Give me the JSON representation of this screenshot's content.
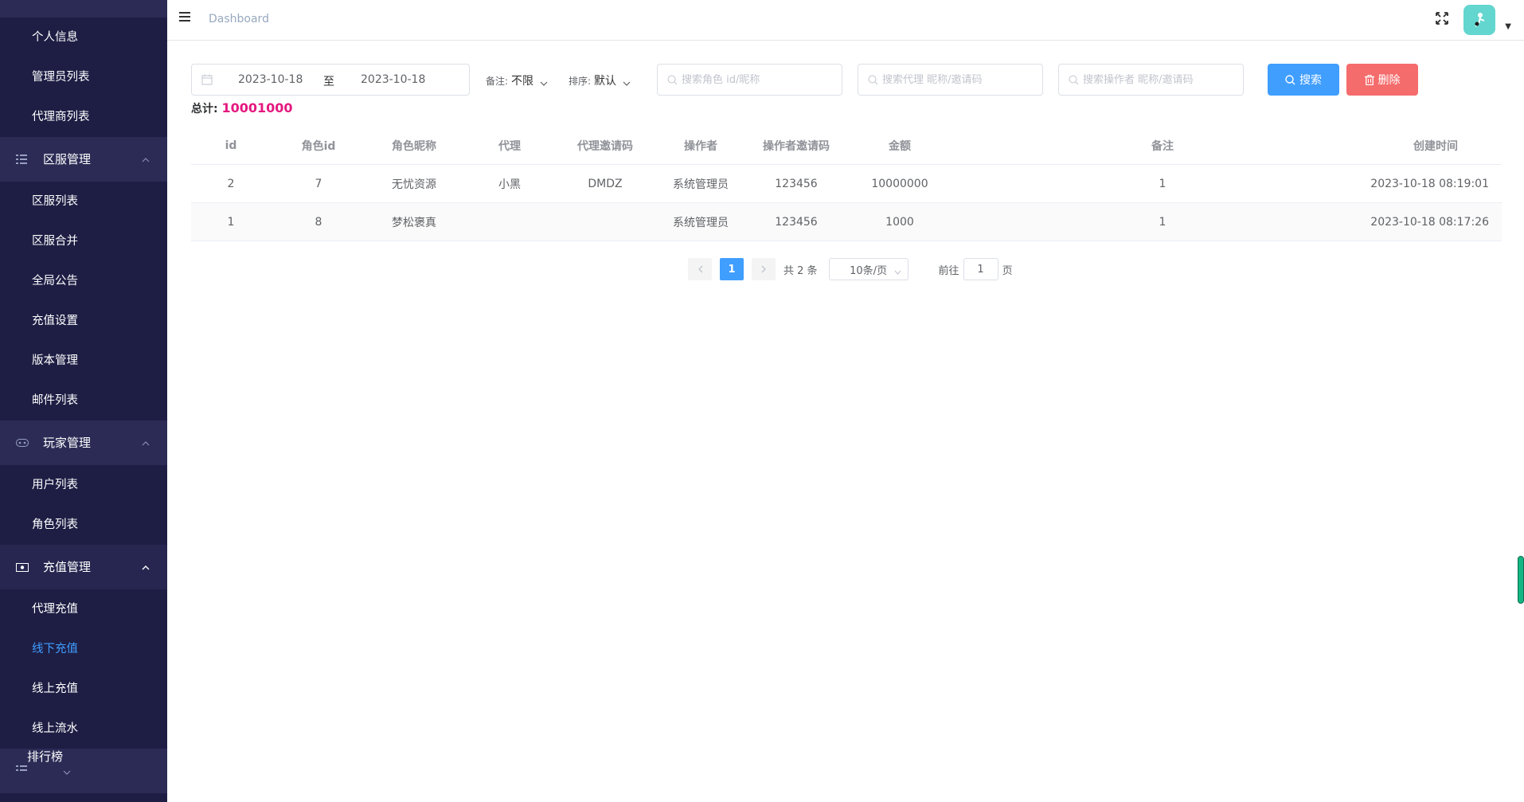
{
  "sidebar": {
    "items_top": [
      {
        "label": "个人信息"
      },
      {
        "label": "管理员列表"
      },
      {
        "label": "代理商列表"
      }
    ],
    "group_server": {
      "label": "区服管理",
      "icon": "list-icon"
    },
    "items_server": [
      {
        "label": "区服列表"
      },
      {
        "label": "区服合并"
      },
      {
        "label": "全局公告"
      },
      {
        "label": "充值设置"
      },
      {
        "label": "版本管理"
      },
      {
        "label": "邮件列表"
      }
    ],
    "group_player": {
      "label": "玩家管理",
      "icon": "gamepad-icon"
    },
    "items_player": [
      {
        "label": "用户列表"
      },
      {
        "label": "角色列表"
      }
    ],
    "group_recharge": {
      "label": "充值管理",
      "icon": "money-icon"
    },
    "items_recharge": [
      {
        "label": "代理充值"
      },
      {
        "label": "线下充值",
        "active": true
      },
      {
        "label": "线上充值"
      },
      {
        "label": "线上流水"
      }
    ],
    "group_rank": {
      "label": "排行榜",
      "icon": "list-icon"
    }
  },
  "header": {
    "breadcrumb": "Dashboard"
  },
  "filters": {
    "date_start": "2023-10-18",
    "date_sep": "至",
    "date_end": "2023-10-18",
    "remark_label": "备注:",
    "remark_value": "不限",
    "sort_label": "排序:",
    "sort_value": "默认",
    "search_role_placeholder": "搜索角色 id/昵称",
    "search_agent_placeholder": "搜索代理 昵称/邀请码",
    "search_operator_placeholder": "搜索操作者 昵称/邀请码",
    "search_button": "搜索",
    "delete_button": "删除"
  },
  "summary": {
    "total_label": "总计:",
    "total_value": "10001000"
  },
  "table": {
    "headers": [
      "id",
      "角色id",
      "角色昵称",
      "代理",
      "代理邀请码",
      "操作者",
      "操作者邀请码",
      "金额",
      "备注",
      "创建时间"
    ],
    "rows": [
      [
        "2",
        "7",
        "无忧资源",
        "小黑",
        "DMDZ",
        "系统管理员",
        "123456",
        "10000000",
        "1",
        "2023-10-18 08:19:01"
      ],
      [
        "1",
        "8",
        "梦松褒真",
        "",
        "",
        "系统管理员",
        "123456",
        "1000",
        "1",
        "2023-10-18 08:17:26"
      ]
    ]
  },
  "pagination": {
    "current": "1",
    "total_text": "共 2 条",
    "page_size": "10条/页",
    "goto_label": "前往",
    "goto_value": "1",
    "page_suffix": "页"
  },
  "colors": {
    "sidebar_bg": "#1e1e45",
    "accent": "#409eff",
    "danger": "#f56c6c",
    "total_value": "#e4187f"
  }
}
